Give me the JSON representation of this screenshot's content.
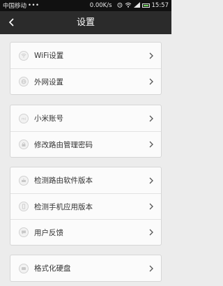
{
  "status_bar": {
    "carrier": "中国移动",
    "dots": "•••",
    "speed": "0.00K/s",
    "time": "15:57",
    "icons": [
      "alarm-icon",
      "wifi-icon",
      "signal-icon",
      "battery-icon"
    ]
  },
  "header": {
    "title": "设置",
    "back_icon": "back-arrow-icon"
  },
  "groups": [
    {
      "items": [
        {
          "label": "WiFi设置",
          "icon": "wifi-icon"
        },
        {
          "label": "外网设置",
          "icon": "globe-icon"
        }
      ]
    },
    {
      "items": [
        {
          "label": "小米账号",
          "icon": "mi-account-icon"
        },
        {
          "label": "修改路由管理密码",
          "icon": "lock-icon"
        }
      ]
    },
    {
      "items": [
        {
          "label": "检测路由软件版本",
          "icon": "router-update-icon"
        },
        {
          "label": "检测手机应用版本",
          "icon": "phone-update-icon"
        },
        {
          "label": "用户反馈",
          "icon": "feedback-icon"
        }
      ]
    },
    {
      "items": [
        {
          "label": "格式化硬盘",
          "icon": "disk-icon"
        }
      ]
    }
  ],
  "colors": {
    "background": "#ececec",
    "title_bar": "#2b2b2b",
    "status_bar": "#111111",
    "card": "#fbfbfb",
    "text": "#333333"
  }
}
